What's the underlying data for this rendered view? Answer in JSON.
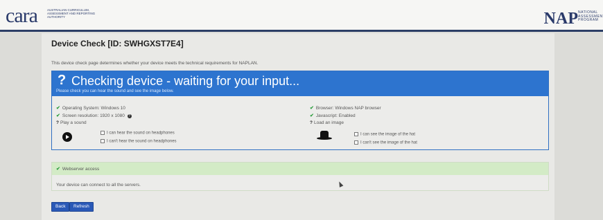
{
  "header": {
    "left_logo": "cara",
    "left_logo_sub": "Australian Curriculum, Assessment and Reporting Authority",
    "right_logo": "NAP",
    "right_logo_sub": "National Assessment Program"
  },
  "page": {
    "title": "Device Check [ID: SWHGXST7E4]",
    "description": "This device check page determines whether your device meets the technical requirements for NAPLAN."
  },
  "check_panel": {
    "title": "Checking device - waiting for your input...",
    "subtitle": "Please check you can hear the sound and see the image below.",
    "os": "Operating System: Windows 10",
    "resolution": "Screen resolution: 1920 x 1080",
    "browser": "Browser: Windows NAP browser",
    "javascript": "Javascript: Enabled",
    "play_sound": "Play a sound",
    "load_image": "Load an image",
    "sound_yes": "I can hear the sound on headphones",
    "sound_no": "I can't hear the sound on headphones",
    "image_yes": "I can see the image of the hat",
    "image_no": "I can't see the image of the hat"
  },
  "webserver_panel": {
    "title": "Webserver access",
    "message": "Your device can connect to all the servers."
  },
  "buttons": {
    "back": "Back",
    "refresh": "Refresh"
  },
  "colors": {
    "accent_blue": "#2d74cf",
    "success_green": "#2e9e3f",
    "success_bg": "#d3ebc6",
    "button_blue": "#2a59b7"
  }
}
